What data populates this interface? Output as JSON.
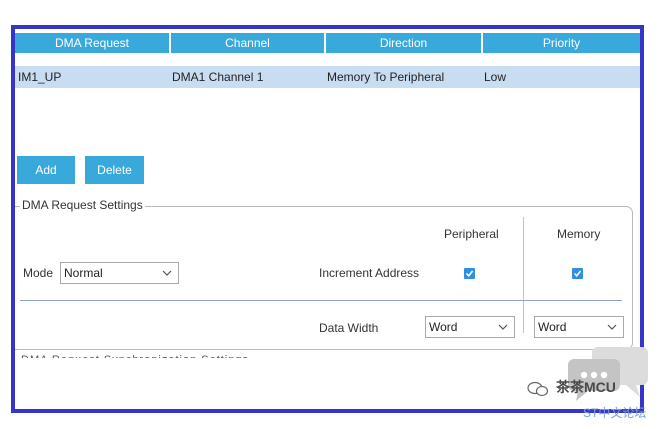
{
  "dma_table": {
    "headers": [
      "DMA Request",
      "Channel",
      "Direction",
      "Priority"
    ],
    "row": {
      "request": "IM1_UP",
      "channel": "DMA1 Channel 1",
      "direction": "Memory To Peripheral",
      "priority": "Low"
    }
  },
  "buttons": {
    "add": "Add",
    "delete": "Delete"
  },
  "settings": {
    "title": "DMA Request Settings",
    "peripheral_header": "Peripheral",
    "memory_header": "Memory",
    "mode_label": "Mode",
    "mode_value": "Normal",
    "increment_label": "Increment Address",
    "peripheral_increment_checked": true,
    "memory_increment_checked": true,
    "data_width_label": "Data Width",
    "peripheral_width": "Word",
    "memory_width": "Word"
  },
  "cut_off_text": "DMA Request Synchronization Settings",
  "watermark": {
    "account": "茶茶MCU",
    "forum": "ST中文论坛"
  },
  "colors": {
    "frame_border": "#3535c9",
    "header_bg": "#39a9dc",
    "selected_row_bg": "#c9ddf2",
    "checkbox": "#2f8fe0"
  }
}
